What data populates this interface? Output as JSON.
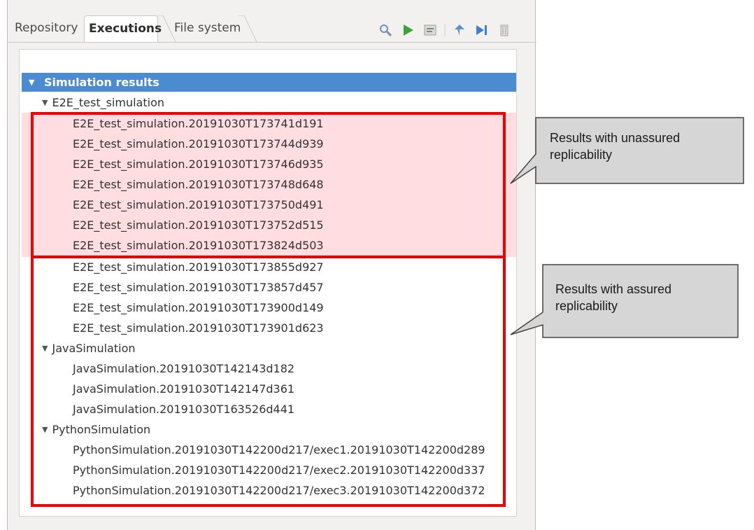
{
  "tabs": [
    {
      "label": "Repository",
      "active": false
    },
    {
      "label": "Executions",
      "active": true
    },
    {
      "label": "File system",
      "active": false
    }
  ],
  "toolbar": {
    "icons": [
      "search-icon",
      "run-icon",
      "settings-icon",
      "pin-icon",
      "step-forward-icon",
      "trash-icon"
    ]
  },
  "tree": {
    "root_label": "Simulation results",
    "groups": [
      {
        "label": "E2E_test_simulation",
        "children": [
          "E2E_test_simulation.20191030T173741d191",
          "E2E_test_simulation.20191030T173744d939",
          "E2E_test_simulation.20191030T173746d935",
          "E2E_test_simulation.20191030T173748d648",
          "E2E_test_simulation.20191030T173750d491",
          "E2E_test_simulation.20191030T173752d515",
          "E2E_test_simulation.20191030T173824d503",
          "E2E_test_simulation.20191030T173855d927",
          "E2E_test_simulation.20191030T173857d457",
          "E2E_test_simulation.20191030T173900d149",
          "E2E_test_simulation.20191030T173901d623"
        ]
      },
      {
        "label": "JavaSimulation",
        "children": [
          "JavaSimulation.20191030T142143d182",
          "JavaSimulation.20191030T142147d361",
          "JavaSimulation.20191030T163526d441"
        ]
      },
      {
        "label": "PythonSimulation",
        "children": [
          "PythonSimulation.20191030T142200d217/exec1.20191030T142200d289",
          "PythonSimulation.20191030T142200d217/exec2.20191030T142200d337",
          "PythonSimulation.20191030T142200d217/exec3.20191030T142200d372"
        ]
      }
    ]
  },
  "callouts": {
    "unassured": "Results with unassured replicability",
    "assured": "Results with assured replicability"
  },
  "colors": {
    "selection": "#4b8bd2",
    "highlight_pink": "#ffdde0",
    "box_red": "#ee0000"
  }
}
